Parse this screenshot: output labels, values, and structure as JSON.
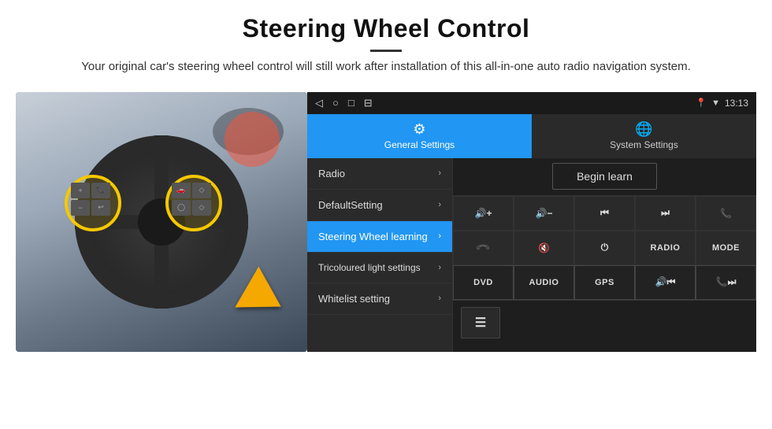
{
  "header": {
    "title": "Steering Wheel Control",
    "subtitle": "Your original car's steering wheel control will still work after installation of this all-in-one auto radio navigation system."
  },
  "status_bar": {
    "time": "13:13",
    "icons": [
      "◁",
      "○",
      "□",
      "⊟"
    ]
  },
  "tabs": [
    {
      "label": "General Settings",
      "active": true,
      "icon": "⚙"
    },
    {
      "label": "System Settings",
      "active": false,
      "icon": "🌐"
    }
  ],
  "menu_items": [
    {
      "label": "Radio",
      "active": false
    },
    {
      "label": "DefaultSetting",
      "active": false
    },
    {
      "label": "Steering Wheel learning",
      "active": true
    },
    {
      "label": "Tricoloured light settings",
      "active": false
    },
    {
      "label": "Whitelist setting",
      "active": false
    }
  ],
  "begin_learn_label": "Begin learn",
  "button_grid_row1": [
    "🔊+",
    "🔊−",
    "⏮",
    "⏭",
    "📞"
  ],
  "button_grid_row2": [
    "📞",
    "🔇",
    "⏻",
    "RADIO",
    "MODE"
  ],
  "button_grid_row3_labels": [
    "DVD",
    "AUDIO",
    "GPS",
    "🔊⏮",
    "📞⏭"
  ]
}
